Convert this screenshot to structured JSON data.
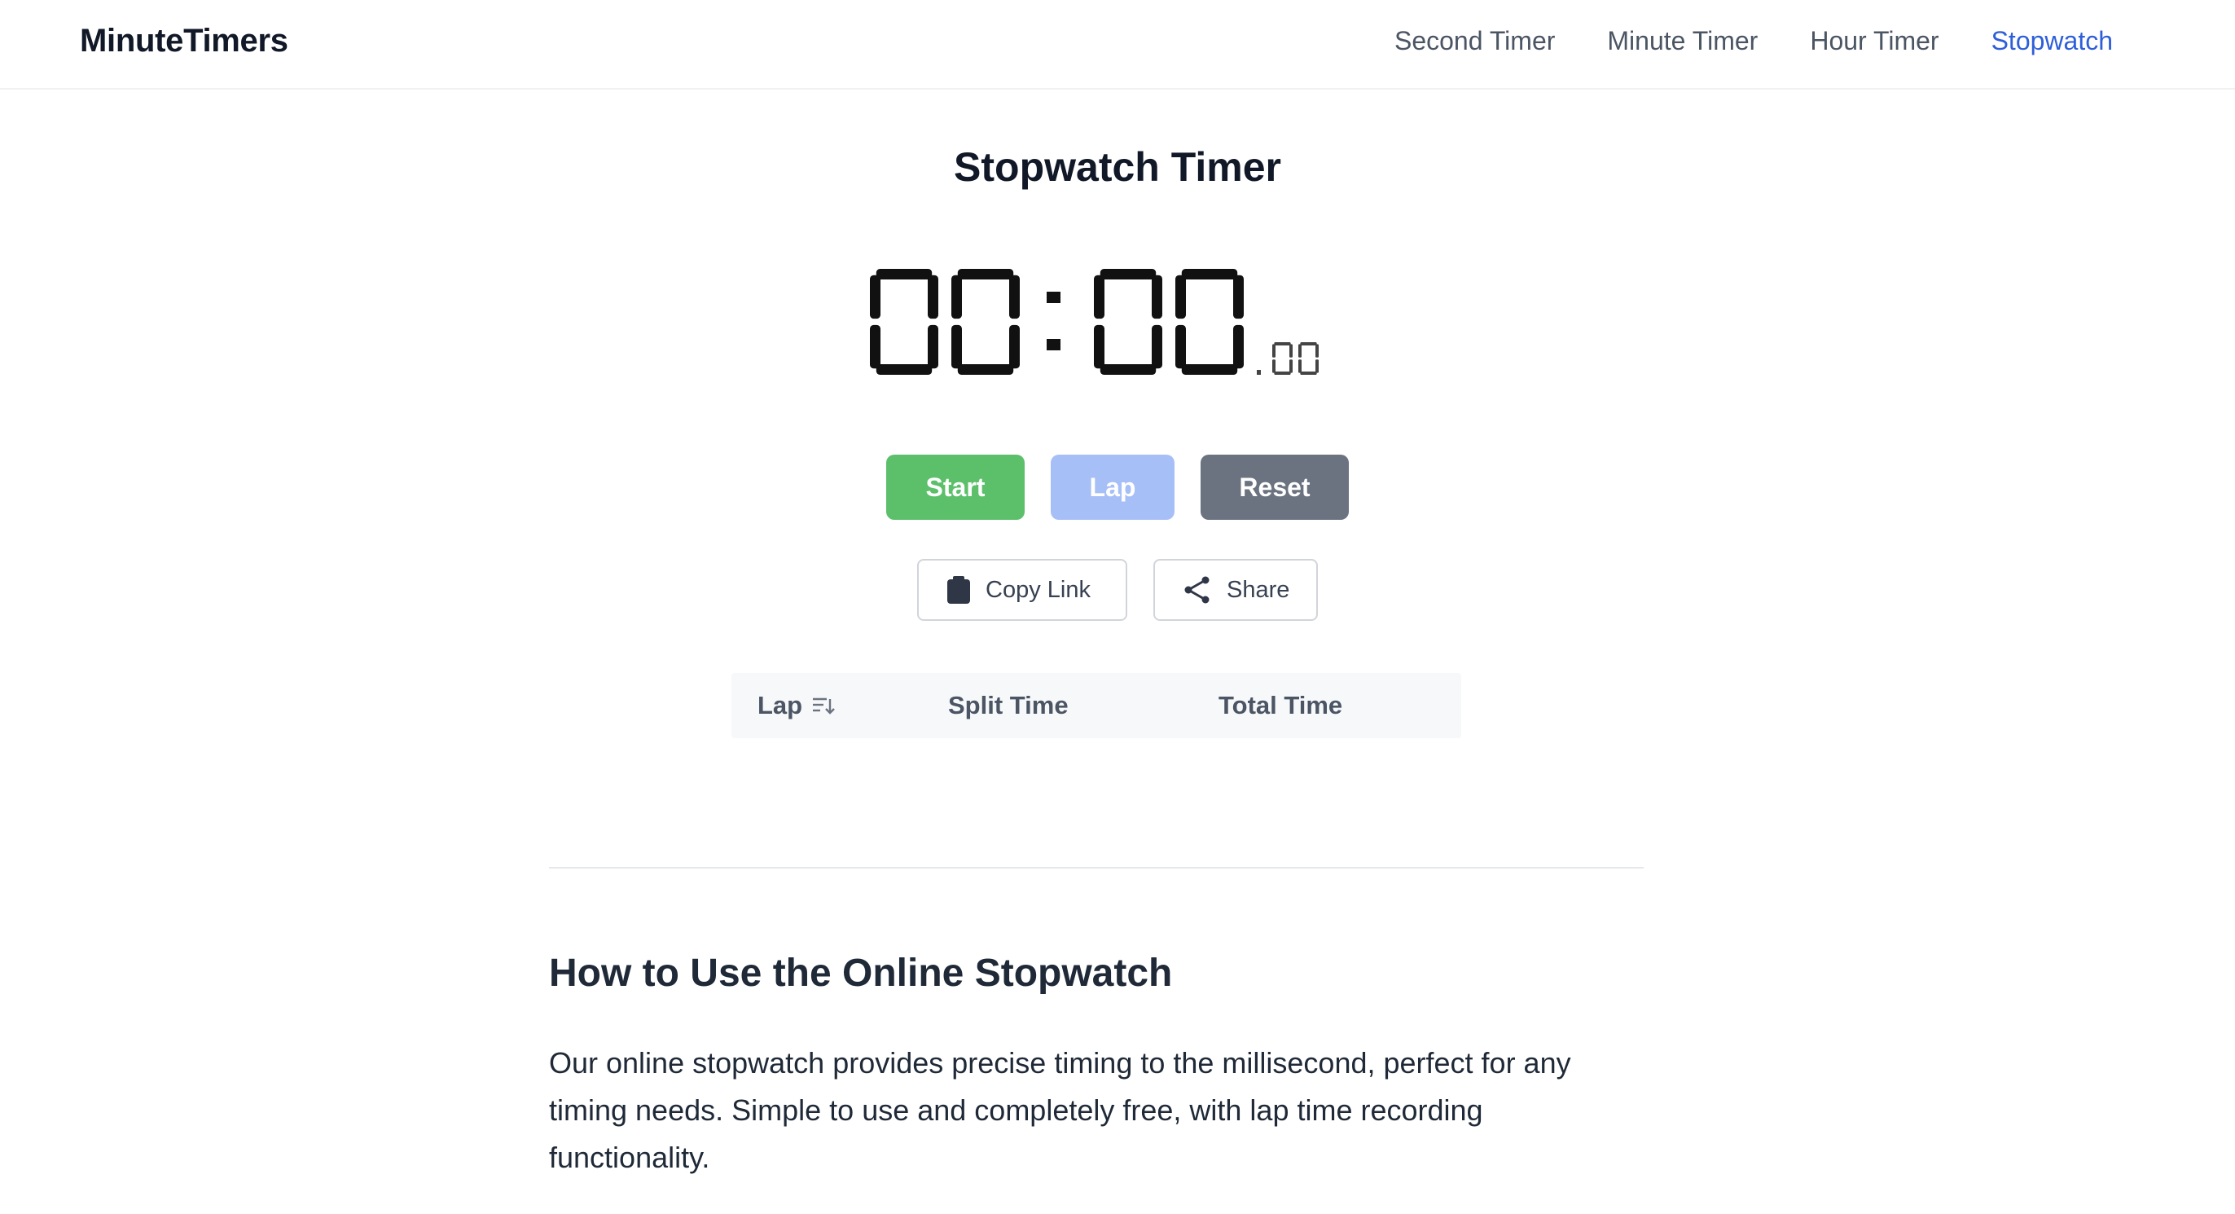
{
  "header": {
    "logo": "MinuteTimers",
    "nav": [
      {
        "label": "Second Timer",
        "active": false
      },
      {
        "label": "Minute Timer",
        "active": false
      },
      {
        "label": "Hour Timer",
        "active": false
      },
      {
        "label": "Stopwatch",
        "active": true
      }
    ]
  },
  "page_title": "Stopwatch Timer",
  "display": {
    "minutes": "00",
    "separator": ":",
    "seconds": "00",
    "centiseconds_prefix": ".",
    "centiseconds": "00"
  },
  "controls": {
    "start_label": "Start",
    "lap_label": "Lap",
    "reset_label": "Reset",
    "copy_link_label": "Copy Link",
    "share_label": "Share"
  },
  "lap_table": {
    "headers": [
      "Lap",
      "Split Time",
      "Total Time"
    ],
    "rows": []
  },
  "content": {
    "heading": "How to Use the Online Stopwatch",
    "paragraph": "Our online stopwatch provides precise timing to the millisecond, perfect for any timing needs. Simple to use and completely free, with lap time recording functionality."
  },
  "colors": {
    "accent": "#2e5fd9",
    "start": "#5cbf6a",
    "lap": "#a7bff7",
    "reset": "#6b7280"
  },
  "icons": {
    "copy": "clipboard-icon",
    "share": "share-icon",
    "sort": "sort-icon"
  }
}
